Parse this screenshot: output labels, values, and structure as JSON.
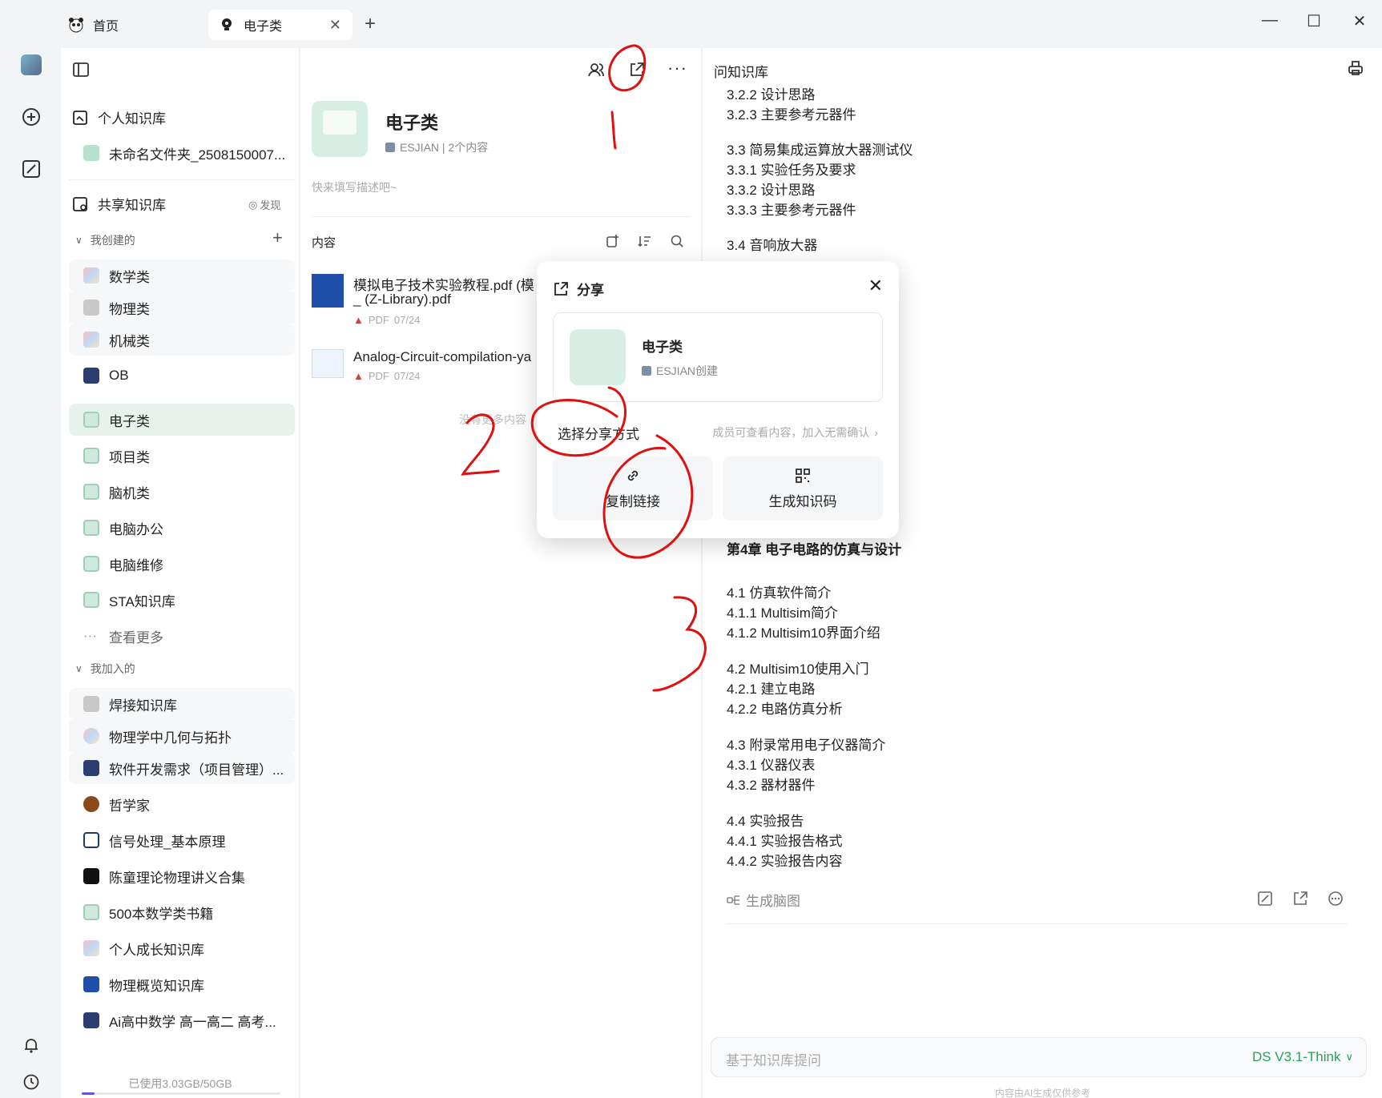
{
  "tabs": {
    "home_label": "首页",
    "active_label": "电子类"
  },
  "sidebar": {
    "personal_kb": "个人知识库",
    "untitled_folder": "未命名文件夹_2508150007...",
    "shared_kb": "共享知识库",
    "discover": "发现",
    "created_group": "我创建的",
    "created_items": [
      {
        "label": "数学类",
        "icon": "multi"
      },
      {
        "label": "物理类",
        "icon": "gray"
      },
      {
        "label": "机械类",
        "icon": "multi"
      },
      {
        "label": "OB",
        "icon": "dark"
      },
      {
        "label": "电子类",
        "icon": "green"
      },
      {
        "label": "项目类",
        "icon": "green"
      },
      {
        "label": "脑机类",
        "icon": "green"
      },
      {
        "label": "电脑办公",
        "icon": "green"
      },
      {
        "label": "电脑维修",
        "icon": "green"
      },
      {
        "label": "STA知识库",
        "icon": "green"
      }
    ],
    "see_more": "查看更多",
    "joined_group": "我加入的",
    "joined_items": [
      {
        "label": "焊接知识库",
        "icon": "gray"
      },
      {
        "label": "物理学中几何与拓扑",
        "icon": "multi"
      },
      {
        "label": "软件开发需求（项目管理）...",
        "icon": "dark"
      },
      {
        "label": "哲学家",
        "icon": "brown"
      },
      {
        "label": "信号处理_基本原理",
        "icon": "outline"
      },
      {
        "label": "陈童理论物理讲义合集",
        "icon": "black"
      },
      {
        "label": "500本数学类书籍",
        "icon": "green"
      },
      {
        "label": "个人成长知识库",
        "icon": "multi"
      },
      {
        "label": "物理概览知识库",
        "icon": "blue"
      },
      {
        "label": "Ai高中数学 高一高二 高考...",
        "icon": "dark"
      }
    ],
    "storage": "已使用3.03GB/50GB"
  },
  "middle": {
    "title": "电子类",
    "meta": "ESJIAN | 2个内容",
    "desc_placeholder": "快来填写描述吧~",
    "content_header": "内容",
    "files": [
      {
        "title_line1": "模拟电子技术实验教程.pdf (模",
        "title_line2": "_ (Z-Library).pdf",
        "type": "PDF",
        "date": "07/24"
      },
      {
        "title_line1": "Analog-Circuit-compilation-ya",
        "title_line2": "",
        "type": "PDF",
        "date": "07/24"
      }
    ],
    "no_more": "没有更多内容"
  },
  "right": {
    "title": "问知识库",
    "toc_top": [
      "3.2.2 设计思路",
      "3.2.3 主要参考元器件"
    ],
    "toc_33": [
      "3.3 简易集成运算放大器测试仪",
      "3.3.1 实验任务及要求",
      "3.3.2 设计思路",
      "3.3.3 主要参考元器件"
    ],
    "toc_34": "3.4 音响放大器",
    "chapter4": "第4章 电子电路的仿真与设计",
    "toc_41": [
      "4.1 仿真软件简介",
      "4.1.1 Multisim简介",
      "4.1.2 Multisim10界面介绍"
    ],
    "toc_42": [
      "4.2 Multisim10使用入门",
      "4.2.1 建立电路",
      "4.2.2 电路仿真分析"
    ],
    "toc_43": [
      "4.3 附录常用电子仪器简介",
      "4.3.1 仪器仪表",
      "4.3.2 器材器件"
    ],
    "toc_44": [
      "4.4 实验报告",
      "4.4.1 实验报告格式",
      "4.4.2 实验报告内容"
    ],
    "mindmap": "生成脑图",
    "ask_placeholder": "基于知识库提问",
    "model": "DS V3.1-Think",
    "disclaimer": "内容由AI生成仅供参考"
  },
  "dialog": {
    "title": "分享",
    "kb_name": "电子类",
    "kb_creator": "ESJIAN创建",
    "choose_label": "选择分享方式",
    "member_hint": "成员可查看内容，加入无需确认",
    "copy_link": "复制链接",
    "gen_code": "生成知识码"
  },
  "colors": {
    "accent_green": "#2e9e5b",
    "annotation_red": "#e01010"
  }
}
